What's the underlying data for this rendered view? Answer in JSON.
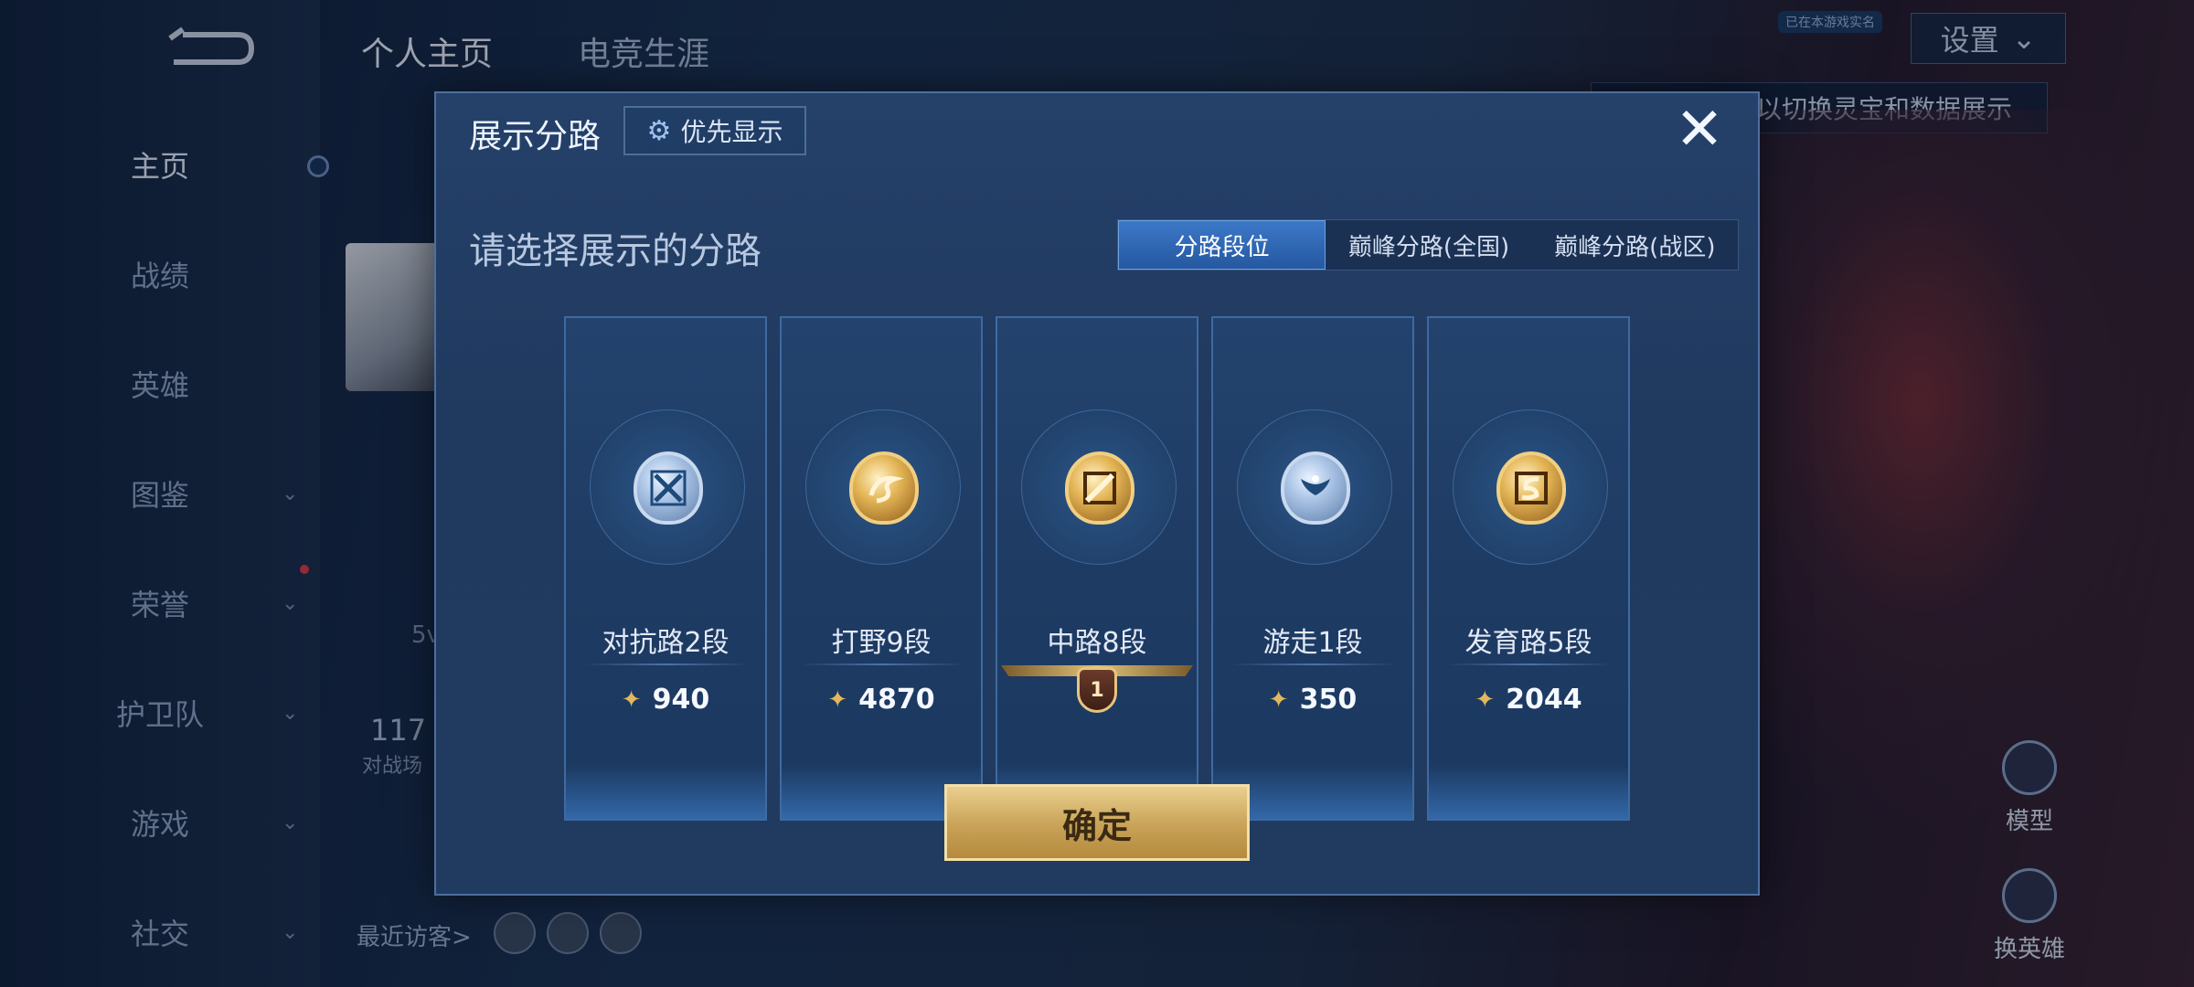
{
  "sidebar": {
    "items": [
      {
        "label": "主页",
        "has_chevron": false
      },
      {
        "label": "战绩",
        "has_chevron": false
      },
      {
        "label": "英雄",
        "has_chevron": false
      },
      {
        "label": "图鉴",
        "has_chevron": true
      },
      {
        "label": "荣誉",
        "has_chevron": true
      },
      {
        "label": "护卫队",
        "has_chevron": true
      },
      {
        "label": "游戏",
        "has_chevron": true
      },
      {
        "label": "社交",
        "has_chevron": true
      }
    ]
  },
  "header": {
    "tabs": [
      "个人主页",
      "电竞生涯"
    ],
    "settings_label": "设置",
    "hint_text": "以切换灵宝和数据展示",
    "small_tag": "已在本游戏实名"
  },
  "profile": {
    "recent_visitors_label": "最近访客>",
    "vv_text": "5v",
    "num_text": "117",
    "sub_text": "对战场"
  },
  "right_panel": {
    "model_label": "模型",
    "switch_hero_label": "换英雄"
  },
  "dialog": {
    "title": "展示分路",
    "priority_label": "优先显示",
    "subheading": "请选择展示的分路",
    "tabs": [
      {
        "label": "分路段位",
        "active": true
      },
      {
        "label": "巅峰分路(全国)",
        "active": false
      },
      {
        "label": "巅峰分路(战区)",
        "active": false
      }
    ],
    "cards": [
      {
        "name": "对抗路2段",
        "points": "940",
        "badge": "silver",
        "icon": "sword-cross-icon"
      },
      {
        "name": "打野9段",
        "points": "4870",
        "badge": "gold",
        "icon": "dragon-icon"
      },
      {
        "name": "中路8段",
        "points": null,
        "rank": "1",
        "badge": "gold",
        "icon": "mid-lane-icon"
      },
      {
        "name": "游走1段",
        "points": "350",
        "badge": "silver",
        "icon": "wings-icon"
      },
      {
        "name": "发育路5段",
        "points": "2044",
        "badge": "gold",
        "icon": "arrow-s-icon"
      }
    ],
    "confirm_label": "确定"
  },
  "colors": {
    "gold": "#e3b455",
    "silver": "#a8c2e4",
    "active_tab": "#3c78c8"
  }
}
